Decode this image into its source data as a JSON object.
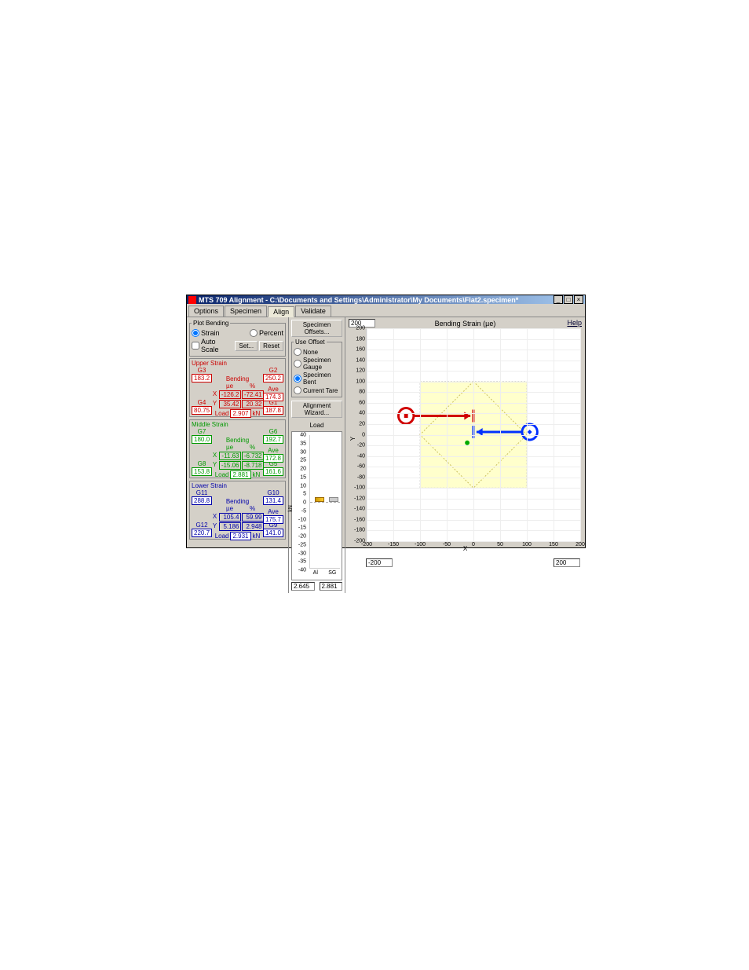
{
  "window": {
    "title": "MTS 709 Alignment - C:\\Documents and Settings\\Administrator\\My Documents\\Flat2.specimen*"
  },
  "tabs": [
    "Options",
    "Specimen",
    "Align",
    "Validate"
  ],
  "activeTab": "Align",
  "plotBending": {
    "legend": "Plot Bending",
    "strain": "Strain",
    "percent": "Percent",
    "autoscale": "Auto Scale",
    "set": "Set...",
    "reset": "Reset"
  },
  "midBtns": {
    "specOffsets": "Specimen Offsets...",
    "useOffset": {
      "legend": "Use Offset",
      "none": "None",
      "gauge": "Specimen Gauge",
      "bent": "Specimen Bent",
      "tare": "Current Tare"
    },
    "alignWizard": "Alignment Wizard...",
    "load": "Load"
  },
  "upper": {
    "title": "Upper Strain",
    "G3": {
      "lbl": "G3",
      "val": "183.2"
    },
    "G2": {
      "lbl": "G2",
      "val": "250.2"
    },
    "G4": {
      "lbl": "G4",
      "val": "80.75"
    },
    "G1": {
      "lbl": "G1",
      "val": "187.8"
    },
    "bending": {
      "title": "Bending",
      "ueLbl": "µe",
      "pctLbl": "%",
      "X": {
        "ue": "-126.2",
        "pct": "-72.41"
      },
      "Y": {
        "ue": "35.42",
        "pct": "20.32"
      },
      "Load": {
        "lbl": "Load",
        "val": "2.907",
        "unit": "kN"
      },
      "Ave": {
        "lbl": "Ave",
        "val": "174.3"
      }
    }
  },
  "middle": {
    "title": "Middle Strain",
    "G7": {
      "lbl": "G7",
      "val": "180.0"
    },
    "G6": {
      "lbl": "G6",
      "val": "192.7"
    },
    "G8": {
      "lbl": "G8",
      "val": "153.8"
    },
    "G5": {
      "lbl": "G5",
      "val": "161.6"
    },
    "bending": {
      "title": "Bending",
      "ueLbl": "µe",
      "pctLbl": "%",
      "X": {
        "ue": "-11.63",
        "pct": "-6.732"
      },
      "Y": {
        "ue": "-15.06",
        "pct": "-8.718"
      },
      "Load": {
        "lbl": "Load",
        "val": "2.881",
        "unit": "kN"
      },
      "Ave": {
        "lbl": "Ave",
        "val": "172.8"
      }
    }
  },
  "lower": {
    "title": "Lower Strain",
    "G11": {
      "lbl": "G11",
      "val": "288.8"
    },
    "G10": {
      "lbl": "G10",
      "val": "131.4"
    },
    "G12": {
      "lbl": "G12",
      "val": "220.7"
    },
    "G9": {
      "lbl": "G9",
      "val": "141.0"
    },
    "bending": {
      "title": "Bending",
      "ueLbl": "µe",
      "pctLbl": "%",
      "X": {
        "ue": "105.4",
        "pct": "59.99"
      },
      "Y": {
        "ue": "5.186",
        "pct": "2.948"
      },
      "Load": {
        "lbl": "Load",
        "val": "2.931",
        "unit": "kN"
      },
      "Ave": {
        "lbl": "Ave",
        "val": "175.7"
      }
    }
  },
  "loadPlot": {
    "ymin": -40,
    "ymax": 40,
    "step": 5,
    "cols": [
      "Al",
      "SG"
    ],
    "kN": "kN",
    "footer": [
      "2.645",
      "2.881"
    ]
  },
  "chart": {
    "title": "Bending Strain (µe)",
    "ylabel": "Y",
    "xlabel": "X",
    "xmin": -200,
    "xmax": 200,
    "xstep": 50,
    "ymin": -200,
    "ymax": 200,
    "ystep": 20,
    "topInput": "200",
    "bottomLeft": "-200",
    "bottomRight": "200"
  },
  "help": "Help",
  "chart_data": {
    "type": "scatter",
    "title": "Bending Strain (µe)",
    "xlabel": "X",
    "ylabel": "Y",
    "xlim": [
      -200,
      200
    ],
    "ylim": [
      -200,
      200
    ],
    "series": [
      {
        "name": "Upper",
        "color": "#d00000",
        "points": [
          {
            "x": -126.2,
            "y": 35.42
          }
        ],
        "target_x": 0
      },
      {
        "name": "Middle",
        "color": "#00aa00",
        "points": [
          {
            "x": -11.63,
            "y": -15.06
          }
        ]
      },
      {
        "name": "Lower",
        "color": "#0030ff",
        "points": [
          {
            "x": 105.4,
            "y": 5.186
          }
        ],
        "target_x": 0
      }
    ]
  }
}
